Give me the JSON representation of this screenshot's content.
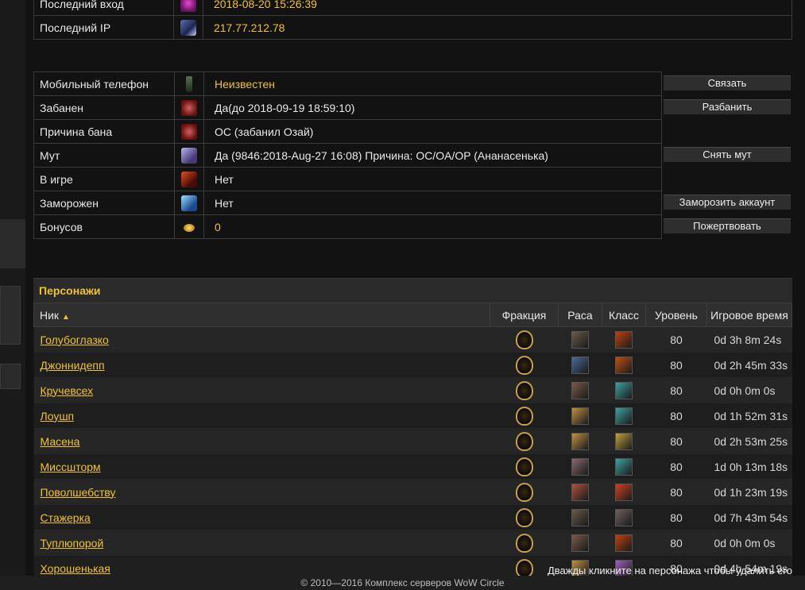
{
  "top_rows": [
    {
      "label": "Последний вход",
      "value": "2018-08-20 15:26:39",
      "icon": "login-icon",
      "color": "yellow"
    },
    {
      "label": "Последний IP",
      "value": "217.77.212.78",
      "icon": "ip-icon",
      "color": "yellow"
    }
  ],
  "status_rows": [
    {
      "label": "Мобильный телефон",
      "value": "Неизвестен",
      "icon": "phone-icon",
      "color": "yellow"
    },
    {
      "label": "Забанен",
      "value": "Да(до 2018-09-19 18:59:10)",
      "icon": "ban-icon",
      "color": "white"
    },
    {
      "label": "Причина бана",
      "value": "ОС (забанил Озай)",
      "icon": "ban-reason-icon",
      "color": "white"
    },
    {
      "label": "Мут",
      "value": "Да (9846:2018-Aug-27 16:08) Причина: OC/OA/OP (Ананасенька)",
      "icon": "mute-icon",
      "color": "white"
    },
    {
      "label": "В игре",
      "value": "Нет",
      "icon": "in-game-icon",
      "color": "white"
    },
    {
      "label": "Заморожен",
      "value": "Нет",
      "icon": "frozen-icon",
      "color": "white"
    },
    {
      "label": "Бонусов",
      "value": "0",
      "icon": "coin-icon",
      "color": "yellow"
    }
  ],
  "buttons": {
    "contact": "Связать",
    "unban": "Разбанить",
    "unmute": "Снять мут",
    "freeze": "Заморозить аккаунт",
    "donate": "Пожертвовать"
  },
  "characters": {
    "title": "Персонажи",
    "columns": {
      "nick": "Ник",
      "faction": "Фракция",
      "race": "Раса",
      "class": "Класс",
      "level": "Уровень",
      "playtime": "Игровое время"
    },
    "rows": [
      {
        "name": "Голубоглазко",
        "faction": "faction-icon",
        "race": "race-icon",
        "class": "class-icon",
        "level": "80",
        "time": "0d 3h 8m 24s"
      },
      {
        "name": "Джоннидепп",
        "faction": "faction-icon",
        "race": "race-icon",
        "class": "class-icon",
        "level": "80",
        "time": "0d 2h 45m 33s"
      },
      {
        "name": "Кручевсех",
        "faction": "faction-icon",
        "race": "race-icon",
        "class": "class-icon",
        "level": "80",
        "time": "0d 0h 0m 0s"
      },
      {
        "name": "Лоушп",
        "faction": "faction-icon",
        "race": "race-icon",
        "class": "class-icon",
        "level": "80",
        "time": "0d 1h 52m 31s"
      },
      {
        "name": "Масена",
        "faction": "faction-icon",
        "race": "race-icon",
        "class": "class-icon",
        "level": "80",
        "time": "0d 2h 53m 25s"
      },
      {
        "name": "Миссшторм",
        "faction": "faction-icon",
        "race": "race-icon",
        "class": "class-icon",
        "level": "80",
        "time": "1d 0h 13m 18s"
      },
      {
        "name": "Поволшебству",
        "faction": "faction-icon",
        "race": "race-icon",
        "class": "class-icon",
        "level": "80",
        "time": "0d 1h 23m 19s"
      },
      {
        "name": "Стажерка",
        "faction": "faction-icon",
        "race": "race-icon",
        "class": "class-icon",
        "level": "80",
        "time": "0d 7h 43m 54s"
      },
      {
        "name": "Туплюпорой",
        "faction": "faction-icon",
        "race": "race-icon",
        "class": "class-icon",
        "level": "80",
        "time": "0d 0h 0m 0s"
      },
      {
        "name": "Хорошенькая",
        "faction": "faction-icon",
        "race": "race-icon",
        "class": "class-icon",
        "level": "80",
        "time": "0d 4h 54m 19s"
      }
    ],
    "hint": "Дважды кликните на персонажа чтобы удалить его"
  },
  "footer": "© 2010—2016 Комплекс серверов WoW Circle",
  "colors": {
    "accent": "#f1c232",
    "bg": "#141414",
    "row_odd": "#262626",
    "row_even": "#1e1e1e"
  }
}
